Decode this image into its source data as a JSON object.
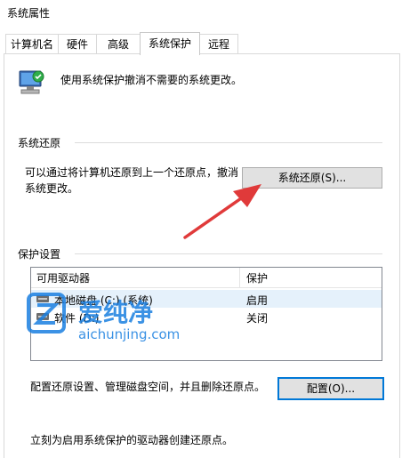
{
  "window": {
    "title": "系统属性"
  },
  "tabs": [
    {
      "label": "计算机名"
    },
    {
      "label": "硬件"
    },
    {
      "label": "高级"
    },
    {
      "label": "系统保护"
    },
    {
      "label": "远程"
    }
  ],
  "active_tab": "系统保护",
  "intro": {
    "text": "使用系统保护撤消不需要的系统更改。"
  },
  "restore_section": {
    "title": "系统还原",
    "description_line1": "可以通过将计算机还原到上一个还原点，撤消",
    "description_line2": "系统更改。",
    "button_label": "系统还原(S)..."
  },
  "protection_section": {
    "title": "保护设置",
    "columns": {
      "drive": "可用驱动器",
      "protection": "保护"
    },
    "drives": [
      {
        "name": "本地磁盘 (C:) (系统)",
        "protection": "启用",
        "selected": true
      },
      {
        "name": "软件 (D:)",
        "protection": "关闭",
        "selected": false
      }
    ],
    "configure_text": "配置还原设置、管理磁盘空间，并且删除还原点。",
    "configure_button": "配置(O)...",
    "create_text": "立刻为启用系统保护的驱动器创建还原点。"
  },
  "watermark": {
    "text_cn": "爱纯净",
    "url": "aichunjing.com",
    "color": "#1a7fe0"
  },
  "annotation": {
    "arrow_color": "#e03a3a"
  }
}
